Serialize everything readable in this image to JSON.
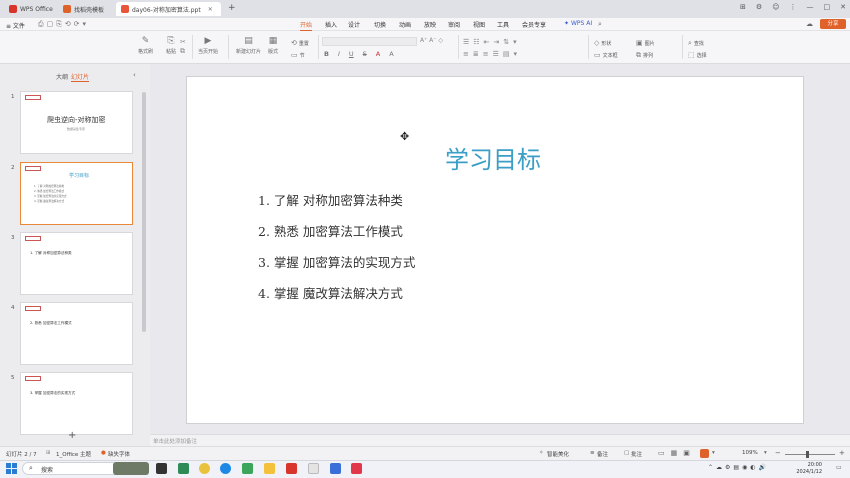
{
  "titlebar": {
    "tabs": [
      {
        "label": "WPS Office"
      },
      {
        "label": "找稻壳模板"
      },
      {
        "label": "day06-对称加密算法.ppt"
      }
    ],
    "new_tab": "+",
    "controls": [
      "⊞",
      "⚙",
      "☺",
      "⋮",
      "—",
      "□",
      "✕"
    ]
  },
  "menubar": {
    "file": "≡ 文件",
    "items": [
      "开始",
      "插入",
      "设计",
      "切换",
      "动画",
      "放映",
      "审阅",
      "视图",
      "工具",
      "会员专享"
    ],
    "wps_ai": "WPS AI",
    "share": "分享",
    "active": "开始"
  },
  "ribbon": {
    "format_painter": "格式刷",
    "paste": "粘贴",
    "play_current": "当页开始",
    "new_slide": "新建幻灯片",
    "layout": "版式",
    "section": "节",
    "reset": "重置",
    "shape": "形状",
    "picture": "图片",
    "textbox": "文本框",
    "arrange": "排列",
    "find": "查找",
    "select": "选择",
    "font_buttons": [
      "B",
      "I",
      "U",
      "S",
      "A",
      "A"
    ]
  },
  "sidebar": {
    "tab_outline": "大纲",
    "tab_slides": "幻灯片",
    "add": "+",
    "thumbs": [
      {
        "num": "1",
        "title": "爬虫逆向-对称加密",
        "subtitle": "数据采集专家"
      },
      {
        "num": "2",
        "title": "学习目标",
        "lines": [
          "1. 了解 对称加密算法种类",
          "2. 熟悉 加密算法工作模式",
          "3. 掌握 加密算法的实现方式",
          "4. 掌握 魔改算法解决方式"
        ]
      },
      {
        "num": "3",
        "title": "1. 了解 对称加密算法种类"
      },
      {
        "num": "4",
        "title": "2. 熟悉 加密算法工作模式"
      },
      {
        "num": "5",
        "title": "3. 掌握 加密算法的实现方式"
      }
    ]
  },
  "slide": {
    "title": "学习目标",
    "bullets": [
      "1. 了解 对称加密算法种类",
      "2. 熟悉 加密算法工作模式",
      "3. 掌握 加密算法的实现方式",
      "4. 掌握 魔改算法解决方式"
    ]
  },
  "notes": {
    "placeholder": "单击此处添加备注"
  },
  "statusbar": {
    "slide_count": "幻灯片 2 / 7",
    "theme": "1_Office 主题",
    "missing_font": "缺失字体",
    "smart_beautify": "智能美化",
    "notes": "备注",
    "comments": "批注",
    "zoom": "109%"
  },
  "taskbar": {
    "search": "搜索",
    "time": "20:00",
    "date": "2024/1/12"
  },
  "colors": {
    "accent": "#e0622b",
    "title_blue": "#3a9ec7",
    "selected_border": "#e8883a"
  }
}
